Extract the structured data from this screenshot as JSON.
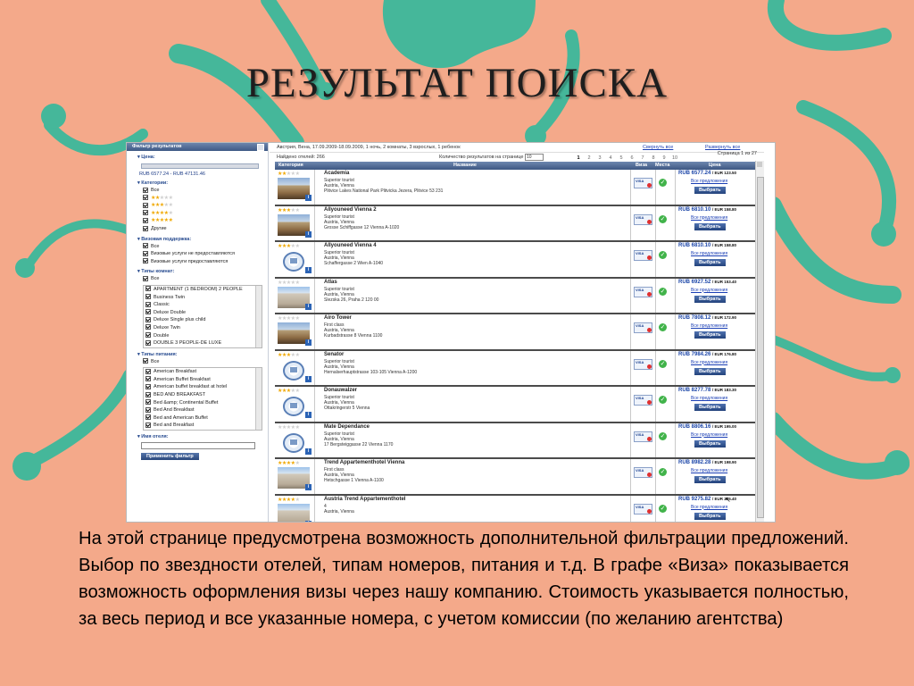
{
  "slide": {
    "title": "РЕЗУЛЬТАТ ПОИСКА",
    "caption": "На этой странице предусмотрена возможность дополнительной фильтрации предложений. Выбор по звездности отелей, типам номеров, питания и т.д. В графе «Виза» показывается возможность оформления визы через нашу компанию. Стоимость указывается полностью, за весь период и все указанные номера, с учетом комиссии (по желанию агентства)",
    "bg_color": "#f4a98a",
    "deco_color": "#45b79a"
  },
  "sidebar": {
    "header": "Фильтр результатов",
    "price_label": "Цена:",
    "price_range": "RUB 6577.24 - RUB 47131.46",
    "category_label": "Категории:",
    "category_items": [
      {
        "label": "Все",
        "checked": true
      },
      {
        "stars": 2,
        "checked": true
      },
      {
        "stars": 3,
        "checked": true
      },
      {
        "stars": 4,
        "checked": true
      },
      {
        "stars": 5,
        "checked": true
      },
      {
        "label": "Другие",
        "checked": true
      }
    ],
    "visa_label": "Визовая поддержка:",
    "visa_items": [
      "Все",
      "Визовые услуги не предоставляются",
      "Визовые услуги предоставляются"
    ],
    "room_label": "Типы комнат:",
    "room_all": "Все",
    "room_items": [
      "APARTMENT (1 BEDROOM) 2 PEOPLE",
      "Business Twin",
      "Classic",
      "Deluxe Double",
      "Deluxe Single plus child",
      "Deluxe Twin",
      "Double",
      "DOUBLE 3 PEOPLE-DE LUXE"
    ],
    "meal_label": "Типы питания:",
    "meal_all": "Все",
    "meal_items": [
      "American Breakfast",
      "American Buffet Breakfast",
      "American buffet breakfast at hotel",
      "BED AND BREAKFAST",
      "Bed &amp; Continental Buffet",
      "Bed And Breakfast",
      "Bed and American Buffet",
      "Bed and Breakfast"
    ],
    "name_label": "Имя отеля:",
    "apply_button": "Применить фильтр"
  },
  "main": {
    "summary": "Австрия, Вена, 17.09.2009-18.09.2009, 1 ночь, 2 комнаты, 3 взрослых, 1 ребенок",
    "collapse_all": "Свернуть все",
    "expand_all": "Развернуть все",
    "found": "Найдено отелей: 266",
    "per_page_label": "Количество результатов на странице",
    "per_page_value": "10",
    "pages": [
      "1",
      "2",
      "3",
      "4",
      "5",
      "6",
      "7",
      "8",
      "9",
      "10"
    ],
    "current_page": "1",
    "page_of": "Страница 1 из 27",
    "col_category": "Категория",
    "col_name": "Название",
    "col_visa": "Виза",
    "col_places": "Места",
    "col_price": "Цена",
    "visa_text": "VISA",
    "all_offers": "Все предложения",
    "choose_button": "Выбрать",
    "scroll_position": 0.02
  },
  "hotels": [
    {
      "stars": 2,
      "name": "Academia",
      "category": "Superior tourist",
      "location": "Austria, Vienna",
      "address": "Plitvice Lakes National Park Plitvicka Jezera, Plitvice 53 231",
      "price": "RUB 6577.24",
      "eur": "/ EUR 123.50",
      "image": "photo"
    },
    {
      "stars": 3,
      "name": "Allyouneed Vienna 2",
      "category": "Superior tourist",
      "location": "Austria, Vienna",
      "address": "Grosse Schiffgasse 12 Vienna A-1020",
      "price": "RUB 6810.10",
      "eur": "/ EUR 158.80",
      "image": "photo"
    },
    {
      "stars": 3,
      "name": "Allyouneed Vienna 4",
      "category": "Superior tourist",
      "location": "Austria, Vienna",
      "address": "Schaffergasse 2 Wien A-1040",
      "price": "RUB 6810.10",
      "eur": "/ EUR 158.80",
      "image": "noimg"
    },
    {
      "stars": 0,
      "name": "Atlas",
      "category": "Superior tourist",
      "location": "Austria, Vienna",
      "address": "Slezska 26, Praha 2 120 00",
      "price": "RUB 6927.52",
      "eur": "/ EUR 153.40",
      "image": "building"
    },
    {
      "stars": 0,
      "name": "Airo Tower",
      "category": "First class",
      "location": "Austria, Vienna",
      "address": "Kurbadstrasse 8 Vienna 1100",
      "price": "RUB 7808.12",
      "eur": "/ EUR 172.90",
      "image": "photo"
    },
    {
      "stars": 3,
      "name": "Senator",
      "category": "Superior tourist",
      "location": "Austria, Vienna",
      "address": "Hernalserhauptstrasse 103-105 Vienna A-1200",
      "price": "RUB 7984.26",
      "eur": "/ EUR 176.80",
      "image": "noimg"
    },
    {
      "stars": 3,
      "name": "Donauwalzer",
      "category": "Superior tourist",
      "location": "Austria, Vienna",
      "address": "Ottakringerstr 5 Vienna",
      "price": "RUB 8277.78",
      "eur": "/ EUR 183.30",
      "image": "noimg"
    },
    {
      "stars": 0,
      "name": "Mate Dependance",
      "category": "Superior tourist",
      "location": "Austria, Vienna",
      "address": "17 Bergsteiggasse 22 Vienna 1170",
      "price": "RUB 8806.16",
      "eur": "/ EUR 195.00",
      "image": "noimg"
    },
    {
      "stars": 4,
      "name": "Trend Appartementhotel Vienna",
      "category": "First class",
      "location": "Austria, Vienna",
      "address": "Hetschgasse 1 Vienna A-1100",
      "price": "RUB 8982.28",
      "eur": "/ EUR 198.90",
      "image": "building"
    },
    {
      "stars": 4,
      "name": "Austria Trend Appartementhotel",
      "category": "4",
      "location": "Austria, Vienna",
      "address": "",
      "price": "RUB 9275.82",
      "eur": "/ EUR 205.40",
      "image": "building"
    }
  ]
}
